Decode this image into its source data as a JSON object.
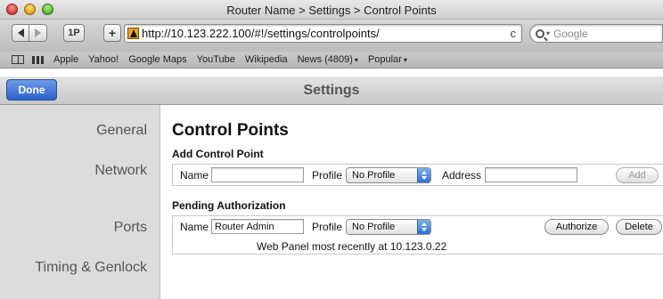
{
  "window": {
    "title": "Router Name > Settings > Control Points"
  },
  "toolbar": {
    "one_password_label": "1P",
    "add_bookmark_label": "+",
    "url": "http://10.123.222.100/#!/settings/controlpoints/",
    "reload_glyph": "c",
    "search_placeholder": "Google"
  },
  "bookmarks": {
    "items": [
      "Apple",
      "Yahoo!",
      "Google Maps",
      "YouTube",
      "Wikipedia",
      "News (4809)",
      "Popular"
    ],
    "caret": "▾"
  },
  "header": {
    "done_label": "Done",
    "title": "Settings",
    "accent_color": "#2d62cc"
  },
  "sidebar": {
    "items": [
      "General",
      "Network",
      "Ports",
      "Timing & Genlock"
    ]
  },
  "main": {
    "page_title": "Control Points",
    "add_section": {
      "heading": "Add Control Point",
      "name_label": "Name",
      "name_value": "",
      "profile_label": "Profile",
      "profile_selected": "No Profile",
      "address_label": "Address",
      "address_value": "",
      "add_button": "Add"
    },
    "pending_section": {
      "heading": "Pending Authorization",
      "name_label": "Name",
      "name_value": "Router Admin",
      "profile_label": "Profile",
      "profile_selected": "No Profile",
      "authorize_button": "Authorize",
      "delete_button": "Delete",
      "status": "Web Panel most recently at 10.123.0.22"
    }
  }
}
